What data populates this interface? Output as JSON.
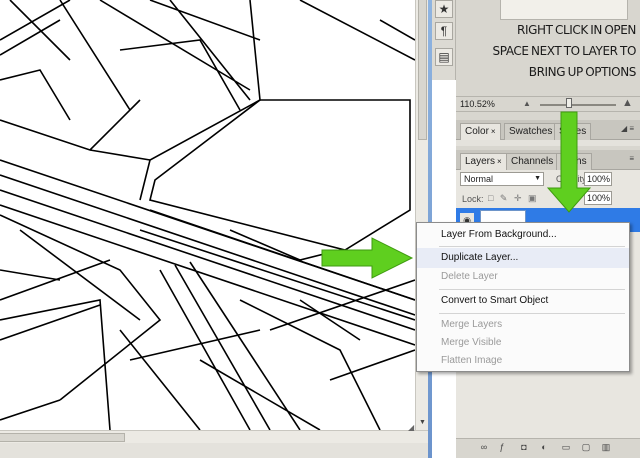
{
  "instruction": {
    "lines": [
      "RIGHT CLICK IN OPEN",
      "SPACE NEXT TO LAYER TO",
      "BRING UP OPTIONS"
    ]
  },
  "tools": {
    "top_glyph": "★",
    "paragraph_glyph": "¶",
    "panel_glyph": "▤"
  },
  "navigator": {
    "zoom": "110.52%"
  },
  "color_panel": {
    "tabs": [
      "Color",
      "Swatches",
      "Styles"
    ],
    "close_glyph": "×"
  },
  "layers_panel": {
    "tabs": [
      "Layers",
      "Channels",
      "Paths"
    ],
    "close_glyph": "×",
    "blend_mode": "Normal",
    "opacity_label": "Opacity:",
    "opacity": "100%",
    "lock_label": "Lock:",
    "lock_glyphs": "□ ✎ ✛ ▣",
    "fill": "100%"
  },
  "context_menu": {
    "items": [
      {
        "label": "Layer From Background...",
        "enabled": true
      },
      {
        "label": "Duplicate Layer...",
        "enabled": true
      },
      {
        "label": "Delete Layer",
        "enabled": false
      },
      {
        "label": "Convert to Smart Object",
        "enabled": true
      },
      {
        "label": "Merge Layers",
        "enabled": false
      },
      {
        "label": "Merge Visible",
        "enabled": false
      },
      {
        "label": "Flatten Image",
        "enabled": false
      }
    ]
  },
  "colors": {
    "arrow": "#5fcf1f",
    "layer_highlight": "#2f7be6"
  }
}
